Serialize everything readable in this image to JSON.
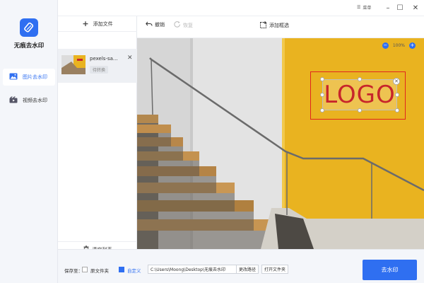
{
  "app": {
    "name": "无痕去水印"
  },
  "sidebar": {
    "items": [
      {
        "label": "图片去水印",
        "icon": "image-icon",
        "active": true
      },
      {
        "label": "视频去水印",
        "icon": "video-icon",
        "active": false
      }
    ]
  },
  "titlebar": {
    "menu_label": "菜单"
  },
  "file_panel": {
    "add_label": "添加文件",
    "files": [
      {
        "name": "pexels-sa...",
        "status": "待转换"
      }
    ],
    "clear_label": "清空列表"
  },
  "toolbar": {
    "undo_label": "撤销",
    "redo_label": "恢复",
    "add_box_label": "添加框选"
  },
  "canvas": {
    "zoom": "100%",
    "watermark_text": "LOGO"
  },
  "bottom": {
    "save_label": "保存至：",
    "option_source": "原文件夹",
    "option_custom": "自定义",
    "path_value": "C:\\Users\\Moong\\Desktop\\无痕去水印",
    "change_path_label": "更改路径",
    "open_folder_label": "打开文件夹",
    "action_label": "去水印"
  },
  "colors": {
    "accent": "#2f6ff1",
    "selection": "#e0251f",
    "wall_yellow": "#e9b320"
  }
}
